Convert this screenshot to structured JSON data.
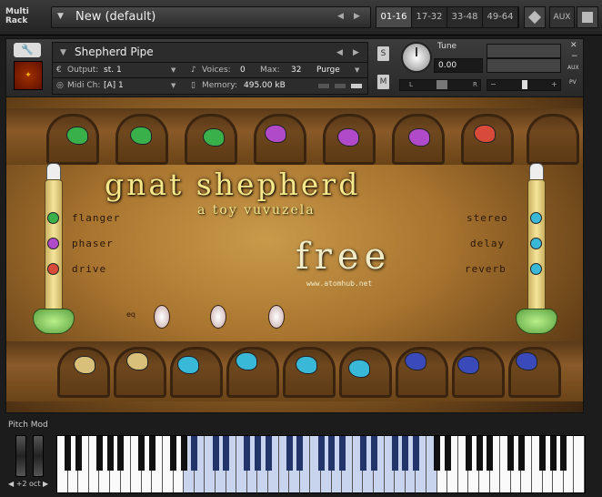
{
  "topbar": {
    "multi_rack_line1": "Multi",
    "multi_rack_line2": "Rack",
    "preset_name": "New (default)",
    "rack_tabs": [
      "01-16",
      "17-32",
      "33-48",
      "49-64"
    ],
    "aux_label": "AUX"
  },
  "instrument": {
    "name": "Shepherd Pipe",
    "output_label": "Output:",
    "output_value": "st. 1",
    "voices_label": "Voices:",
    "voices_value": "0",
    "max_label": "Max:",
    "max_value": "32",
    "purge_label": "Purge",
    "midi_label": "Midi Ch:",
    "midi_value": "[A] 1",
    "memory_label": "Memory:",
    "memory_value": "495.00 kB",
    "solo_label": "S",
    "mute_label": "M",
    "tune_label": "Tune",
    "tune_value": "0.00",
    "pan_left": "L",
    "pan_right": "R",
    "side_aux": "AUX",
    "side_pv": "PV"
  },
  "artwork": {
    "title": "gnat shepherd",
    "subtitle": "a toy vuvuzela",
    "free_text": "free",
    "site_text": "www.atomhub.net",
    "left_effects": [
      "flanger",
      "phaser",
      "drive"
    ],
    "right_effects": [
      "stereo",
      "delay",
      "reverb"
    ],
    "eq_label": "eq"
  },
  "keyboard_panel": {
    "pitch_mod_label": "Pitch Mod",
    "octave_label": "+2 oct"
  },
  "colors": {
    "accent_title": "#f4e88a",
    "gem_green": "#3ab04a",
    "gem_purple": "#b04ac8",
    "gem_red": "#d84a3a",
    "gem_cyan": "#3ab8d8",
    "gem_blue": "#3a4ab8",
    "key_highlight": "#c8d4ee"
  }
}
